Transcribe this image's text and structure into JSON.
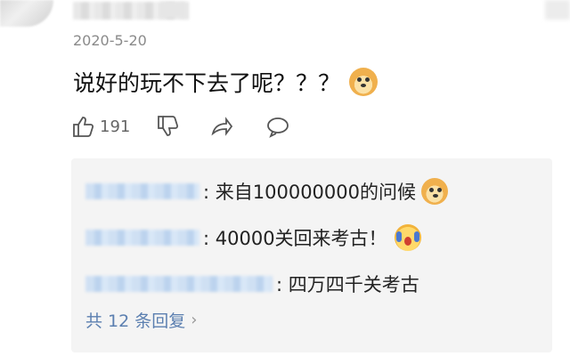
{
  "comment": {
    "timestamp": "2020-5-20",
    "text": "说好的玩不下去了呢？？？",
    "emoji": "doge-icon"
  },
  "actions": {
    "like_count": "191"
  },
  "replies": [
    {
      "text": ": 来自100000000的问候",
      "emoji": "doge-icon"
    },
    {
      "text": ": 40000关回来考古！",
      "emoji": "surprised-face-icon"
    },
    {
      "text": ": 四万四千关考古",
      "emoji": ""
    }
  ],
  "reply_summary": {
    "label": "共 12 条回复",
    "chevron": "›"
  },
  "colors": {
    "link": "#5b7fb0",
    "reply_bg": "#f4f4f4"
  }
}
